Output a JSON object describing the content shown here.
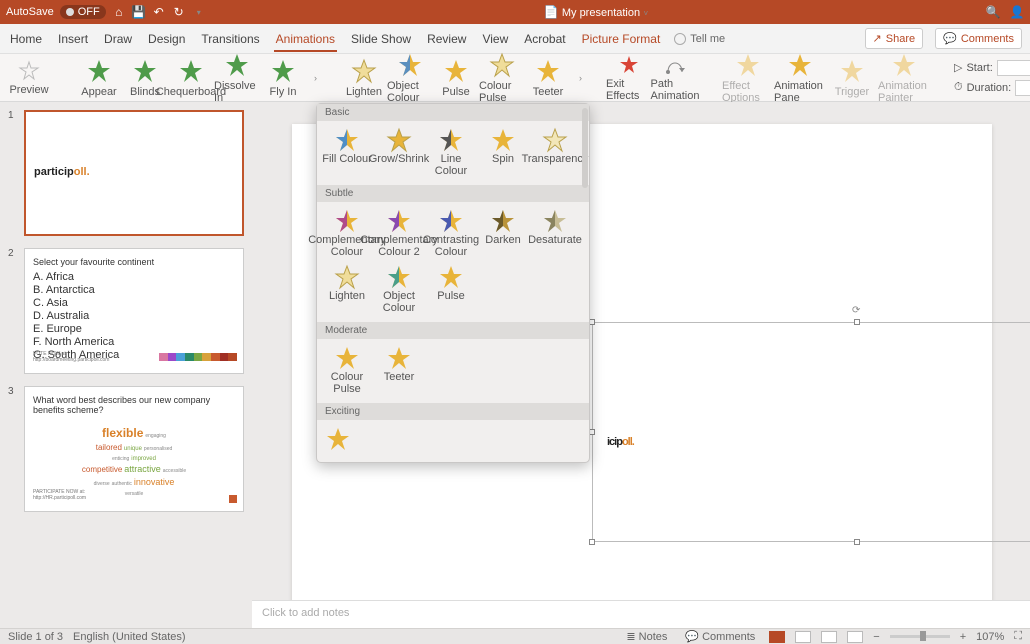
{
  "titlebar": {
    "autosave": "AutoSave",
    "autosave_state": "OFF",
    "title": "My presentation"
  },
  "tabs": [
    "Home",
    "Insert",
    "Draw",
    "Design",
    "Transitions",
    "Animations",
    "Slide Show",
    "Review",
    "View",
    "Acrobat",
    "Picture Format"
  ],
  "active_tab": "Animations",
  "tell_me": "Tell me",
  "share": "Share",
  "comments": "Comments",
  "ribbon": {
    "preview": "Preview",
    "entrance": [
      "Appear",
      "Blinds",
      "Chequerboard",
      "Dissolve In",
      "Fly In"
    ],
    "emphasis": [
      "Lighten",
      "Object Colour",
      "Pulse",
      "Colour Pulse",
      "Teeter"
    ],
    "exit": "Exit Effects",
    "path": "Path Animation",
    "opts": [
      "Effect Options",
      "Animation Pane",
      "Trigger",
      "Animation Painter"
    ],
    "start": "Start:",
    "duration": "Duration:"
  },
  "drop": {
    "g1": "Basic",
    "basic": [
      "Fill Colour",
      "Grow/Shrink",
      "Line Colour",
      "Spin",
      "Transparency"
    ],
    "g2": "Subtle",
    "subtle": [
      "Complementary Colour",
      "Complementary Colour 2",
      "Contrasting Colour",
      "Darken",
      "Desaturate",
      "Lighten",
      "Object Colour",
      "Pulse"
    ],
    "g3": "Moderate",
    "moderate": [
      "Colour Pulse",
      "Teeter"
    ],
    "g4": "Exciting"
  },
  "slides": {
    "s2_title": "Select your favourite continent",
    "s2_items": [
      "A.  Africa",
      "B.  Antarctica",
      "C.  Asia",
      "D.  Australia",
      "E.  Europe",
      "F.  North America",
      "G.  South America"
    ],
    "s2_note": "VOTE NOW at:\nhttp://boardmeeting.participoll.com",
    "s3_title": "What word best describes our new company benefits scheme?",
    "s3_words": {
      "flexible": "flexible",
      "tailored": "tailored",
      "competitive": "competitive",
      "attractive": "attractive",
      "innovative": "innovative",
      "unique": "unique",
      "engaging": "engaging",
      "personalised": "personalised",
      "improved": "improved",
      "accessible": "accessible",
      "diverse": "diverse",
      "enticing": "enticing",
      "authentic": "authentic",
      "versatile": "versatile"
    },
    "s3_note": "PARTICIPATE NOW at:\nhttp://HR.participoll.com"
  },
  "notes": "Click to add notes",
  "status": {
    "slide": "Slide 1 of 3",
    "lang": "English (United States)",
    "notes": "Notes",
    "comments": "Comments",
    "zoom": "107%"
  },
  "logo": {
    "a": "icip",
    "b": "oll",
    "dot": "."
  },
  "thumb_logo": {
    "a": "particip",
    "b": "oll",
    "dot": "."
  },
  "strip_colors": [
    "#d977a1",
    "#9b48c9",
    "#4aa0d8",
    "#2a8a67",
    "#7aa642",
    "#d8a13a",
    "#c85a2e",
    "#a02f24",
    "#b64926"
  ]
}
